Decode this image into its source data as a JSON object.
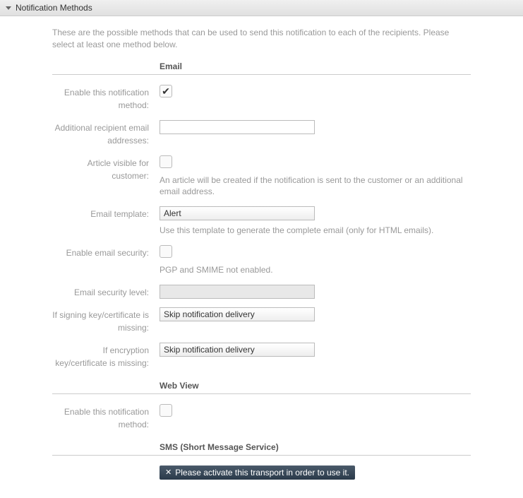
{
  "header": {
    "title": "Notification Methods"
  },
  "intro": "These are the possible methods that can be used to send this notification to each of the recipients. Please select at least one method below.",
  "sections": {
    "email": {
      "title": "Email",
      "enable_label": "Enable this notification method:",
      "recipients_label": "Additional recipient email addresses:",
      "recipients_value": "",
      "article_visible_label": "Article visible for customer:",
      "article_hint": "An article will be created if the notification is sent to the customer or an additional email address.",
      "template_label": "Email template:",
      "template_value": "Alert",
      "template_hint": "Use this template to generate the complete email (only for HTML emails).",
      "security_label": "Enable email security:",
      "security_hint": "PGP and SMIME not enabled.",
      "security_level_label": "Email security level:",
      "security_level_value": "",
      "signing_missing_label": "If signing key/certificate is missing:",
      "signing_missing_value": "Skip notification delivery",
      "encryption_missing_label": "If encryption key/certificate is missing:",
      "encryption_missing_value": "Skip notification delivery"
    },
    "webview": {
      "title": "Web View",
      "enable_label": "Enable this notification method:"
    },
    "sms": {
      "title": "SMS (Short Message Service)",
      "warning": "Please activate this transport in order to use it."
    }
  }
}
